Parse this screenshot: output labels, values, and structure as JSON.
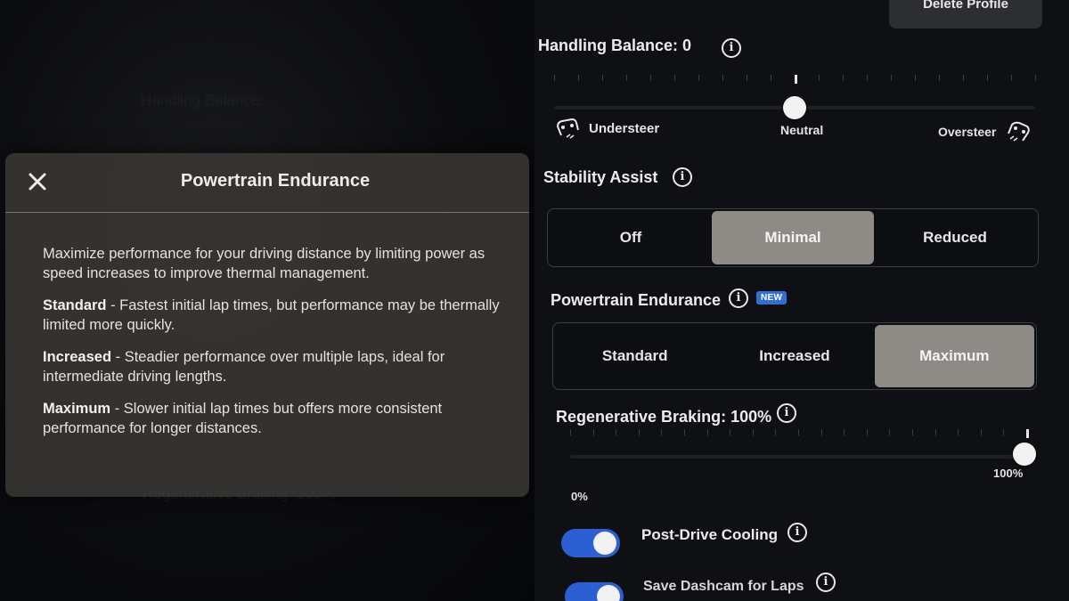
{
  "background": {
    "ghost_handling_label": "Handling Balance:",
    "ghost_regen_label": "Regenerative Braking: 100%"
  },
  "info_modal": {
    "title": "Powertrain Endurance",
    "close_icon": "close-icon",
    "intro": "Maximize performance for your driving distance by limiting power as speed increases to improve thermal management.",
    "items": [
      {
        "term": "Standard",
        "text": " - Fastest initial lap times, but performance may be thermally limited more quickly."
      },
      {
        "term": "Increased",
        "text": " - Steadier performance over multiple laps, ideal for intermediate driving lengths."
      },
      {
        "term": "Maximum",
        "text": " - Slower initial lap times but offers more consistent performance for longer distances."
      }
    ]
  },
  "header": {
    "delete_profile_label": "Delete Profile"
  },
  "handling_balance": {
    "label": "Handling Balance: 0",
    "value": 0,
    "range": [
      -10,
      10
    ],
    "left_label": "Understeer",
    "center_label": "Neutral",
    "right_label": "Oversteer",
    "left_icon": "understeer-car-icon",
    "right_icon": "oversteer-car-icon"
  },
  "stability_assist": {
    "label": "Stability Assist",
    "options": [
      "Off",
      "Minimal",
      "Reduced"
    ],
    "selected": "Minimal"
  },
  "powertrain_endurance": {
    "label": "Powertrain Endurance",
    "badge": "NEW",
    "options": [
      "Standard",
      "Increased",
      "Maximum"
    ],
    "selected": "Maximum"
  },
  "regenerative_braking": {
    "label": "Regenerative Braking: 100%",
    "value_percent": 100,
    "min_label": "0%",
    "max_label": "100%"
  },
  "post_drive_cooling": {
    "label": "Post-Drive Cooling",
    "enabled": true
  },
  "save_dashcam": {
    "label": "Save Dashcam for Laps",
    "enabled": true
  },
  "colors": {
    "accent_blue": "#2c5fd1",
    "selected_segment": "#8e8b86",
    "panel_bg": "#0f1013"
  }
}
